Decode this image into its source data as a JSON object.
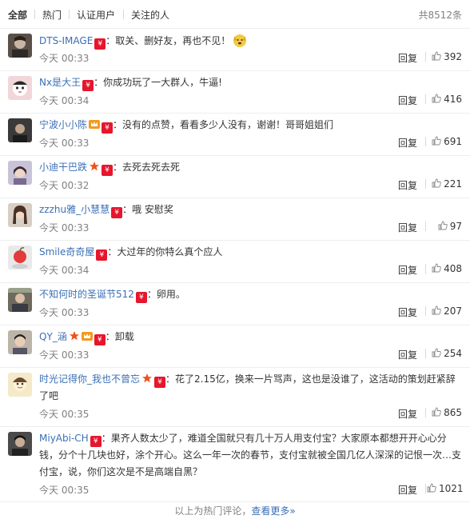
{
  "tabs": [
    {
      "label": "全部",
      "active": true
    },
    {
      "label": "热门",
      "active": false
    },
    {
      "label": "认证用户",
      "active": false
    },
    {
      "label": "关注的人",
      "active": false
    }
  ],
  "total": "共8512条",
  "reply_label": "回复",
  "comments": [
    {
      "user": "DTS-IMAGE",
      "text": "：取关、删好友，再也不见！",
      "time": "今天 00:33",
      "likes": "392",
      "emoji": "dog-face-icon"
    },
    {
      "user": "Nx是大王",
      "text": "：你成功玩了一大群人，牛逼!",
      "time": "今天 00:34",
      "likes": "416"
    },
    {
      "user": "宁波小小陈",
      "text": "：没有的点赞，看看多少人没有，谢谢！哥哥姐姐们",
      "time": "今天 00:33",
      "likes": "691"
    },
    {
      "user": "小迪干巴跌",
      "text": "：去死去死去死",
      "time": "今天 00:32",
      "likes": "221"
    },
    {
      "user": "zzzhu雅_小慧慧",
      "text": "：哦 安慰奖",
      "time": "今天 00:33",
      "likes": "97"
    },
    {
      "user": "Smile奇奇屋",
      "text": "：大过年的你特么真个应人",
      "time": "今天 00:34",
      "likes": "408"
    },
    {
      "user": "不知何时的圣诞节512",
      "text": "：卵用。",
      "time": "今天 00:33",
      "likes": "207"
    },
    {
      "user": "QY_涵",
      "text": "：卸载",
      "time": "今天 00:33",
      "likes": "254"
    },
    {
      "user": "时光记得你_我也不曾忘",
      "text": "：花了2.15亿，换来一片骂声，这也是没谁了，这活动的策划赶紧辞了吧",
      "time": "今天 00:35",
      "likes": "865"
    },
    {
      "user": "MiyAbi-CH",
      "text": "：果齐人数太少了，难道全国就只有几十万人用支付宝？大家原本都想开开心心分钱，分个十几块也好，涂个开心。这么一年一次的春节，支付宝就被全国几亿人深深的记恨一次…支付宝，说，你们这次是不是高端自黑？",
      "time": "今天 00:35",
      "likes": "1021"
    }
  ],
  "footer": {
    "prefix": "以上为热门评论，",
    "link": "查看更多»"
  }
}
